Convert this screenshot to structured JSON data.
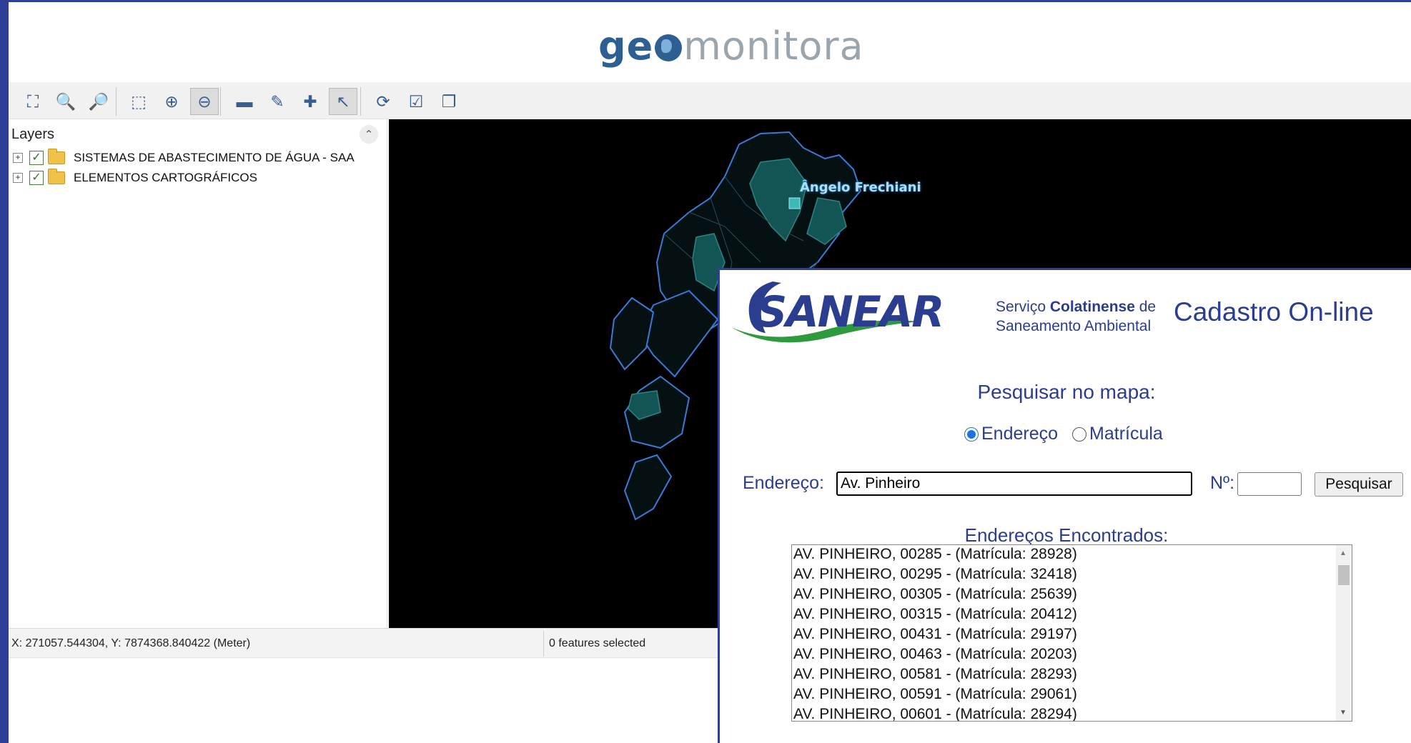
{
  "app": {
    "logo_geo": "ge",
    "logo_monitor": "monitora"
  },
  "toolbar": {
    "buttons": [
      {
        "name": "zoom-extent-icon",
        "glyph": "⛶"
      },
      {
        "name": "zoom-previous-icon",
        "glyph": "🔍"
      },
      {
        "name": "zoom-next-icon",
        "glyph": "🔎"
      },
      {
        "name": "zoom-window-icon",
        "glyph": "⬚"
      },
      {
        "name": "zoom-in-icon",
        "glyph": "⊕"
      },
      {
        "name": "zoom-out-icon",
        "glyph": "⊖"
      },
      {
        "name": "measure-ruler-icon",
        "glyph": "▬"
      },
      {
        "name": "edit-feature-icon",
        "glyph": "✎"
      },
      {
        "name": "add-feature-icon",
        "glyph": "✚"
      },
      {
        "name": "select-pointer-icon",
        "glyph": "↖"
      },
      {
        "name": "identify-icon",
        "glyph": "⟳"
      },
      {
        "name": "attribute-table-icon",
        "glyph": "☑"
      },
      {
        "name": "layers-copy-icon",
        "glyph": "❐"
      }
    ]
  },
  "layers": {
    "title": "Layers",
    "items": [
      {
        "label": "SISTEMAS DE ABASTECIMENTO DE ÁGUA - SAA",
        "checked": true
      },
      {
        "label": "ELEMENTOS CARTOGRÁFICOS",
        "checked": true
      }
    ]
  },
  "map": {
    "label": "Ângelo Frechiani",
    "background": "#000000",
    "outline_color": "#3a7bd5",
    "fill_color": "#1a6a6a"
  },
  "status": {
    "coords": "X: 271057.544304, Y: 7874368.840422 (Meter)",
    "selected": "0 features selected"
  },
  "panel": {
    "logo_text": "SANEAR",
    "org_line1_prefix": "Serviço ",
    "org_line1_bold": "Colatinense",
    "org_line1_suffix": " de",
    "org_line2": "Saneamento Ambiental",
    "title": "Cadastro On-line",
    "search_title": "Pesquisar no mapa:",
    "radio_address": "Endereço",
    "radio_registration": "Matrícula",
    "address_label": "Endereço:",
    "address_value": "Av. Pinheiro",
    "number_label": "Nº:",
    "search_button": "Pesquisar",
    "found_title": "Endereços Encontrados:",
    "results": [
      "AV. PINHEIRO, 00285 - (Matrícula: 28928)",
      "AV. PINHEIRO, 00295 - (Matrícula: 32418)",
      "AV. PINHEIRO, 00305 - (Matrícula: 25639)",
      "AV. PINHEIRO, 00315 - (Matrícula: 20412)",
      "AV. PINHEIRO, 00431 - (Matrícula: 29197)",
      "AV. PINHEIRO, 00463 - (Matrícula: 20203)",
      "AV. PINHEIRO, 00581 - (Matrícula: 28293)",
      "AV. PINHEIRO, 00591 - (Matrícula: 29061)",
      "AV. PINHEIRO, 00601 - (Matrícula: 28294)"
    ],
    "brand_color": "#2b3d8f",
    "swoosh_color": "#2e9a3e"
  }
}
